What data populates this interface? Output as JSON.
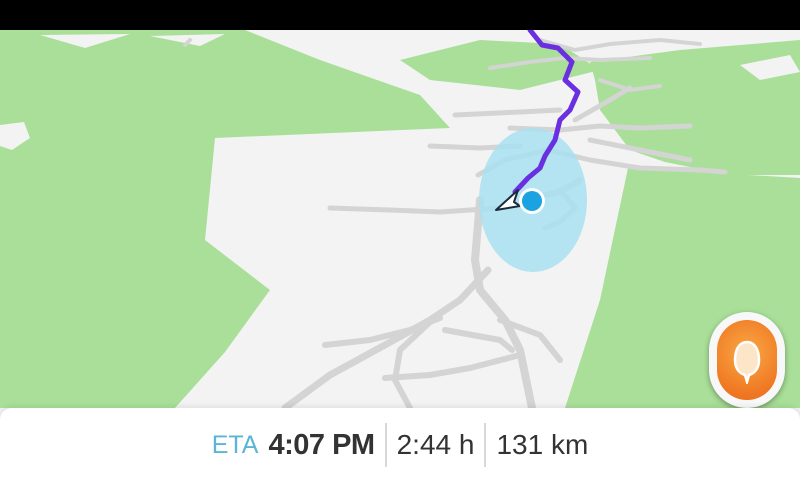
{
  "map": {
    "colors": {
      "background": "#f3f3f3",
      "park": "#a9df98",
      "road": "#d4d4d4",
      "route": "#6a2fe0",
      "accuracy_circle": "#a8dff0",
      "location_dot": "#1aa3e0"
    },
    "icons": {
      "current_location": "location-dot-icon",
      "vehicle": "car-arrow-icon"
    }
  },
  "report_button": {
    "icon": "report-pin-icon",
    "color": "#f07a24"
  },
  "trip": {
    "eta_label": "ETA",
    "eta_time": "4:07 PM",
    "duration": "2:44 h",
    "distance": "131 km"
  }
}
